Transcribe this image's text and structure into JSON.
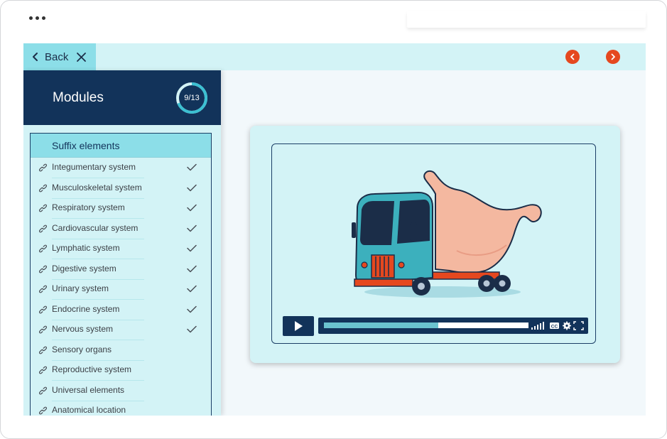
{
  "topbar": {
    "back_label": "Back"
  },
  "modules": {
    "title": "Modules",
    "progress_text": "9/13",
    "progress_fraction": 0.69,
    "section_title": "Suffix elements",
    "items": [
      {
        "label": "Integumentary system",
        "done": true
      },
      {
        "label": "Musculoskeletal system",
        "done": true
      },
      {
        "label": "Respiratory system",
        "done": true
      },
      {
        "label": "Cardiovascular system",
        "done": true
      },
      {
        "label": "Lymphatic system",
        "done": true
      },
      {
        "label": "Digestive system",
        "done": true
      },
      {
        "label": "Urinary system",
        "done": true
      },
      {
        "label": "Endocrine system",
        "done": true
      },
      {
        "label": "Nervous system",
        "done": true
      },
      {
        "label": "Sensory organs",
        "done": false
      },
      {
        "label": "Reproductive system",
        "done": false
      },
      {
        "label": "Universal elements",
        "done": false
      },
      {
        "label": "Anatomical location",
        "done": false
      }
    ]
  },
  "video": {
    "progress_fraction": 0.56
  },
  "colors": {
    "navy": "#12335a",
    "aqua": "#8cdee8",
    "pale": "#d3f3f6",
    "accent": "#e5481f"
  }
}
